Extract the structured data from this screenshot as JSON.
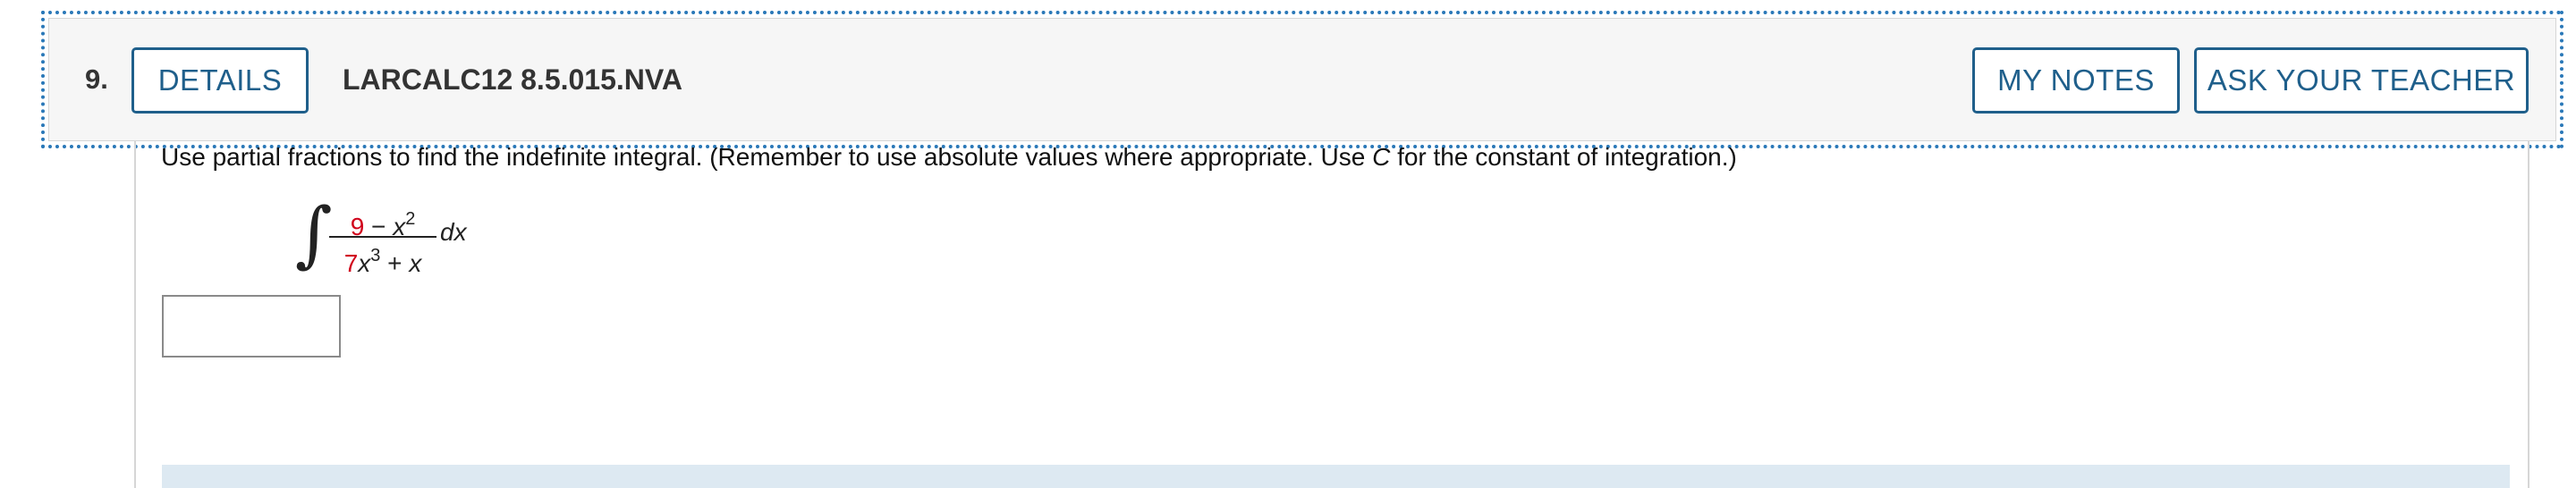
{
  "question": {
    "number": "9.",
    "details_label": "DETAILS",
    "code": "LARCALC12 8.5.015.NVA",
    "my_notes_label": "MY NOTES",
    "ask_teacher_label": "ASK YOUR TEACHER"
  },
  "prompt": {
    "text_before": "Use partial fractions to find the indefinite integral. (Remember to use absolute values where appropriate. Use ",
    "constant": "C",
    "text_after": " for the constant of integration.)"
  },
  "integral": {
    "sign": "∫",
    "num_coef": "9",
    "num_rest": " − ",
    "num_var": "x",
    "num_exp": "2",
    "den_coef": "7",
    "den_var": "x",
    "den_exp": "3",
    "den_rest": " + ",
    "den_var2": "x",
    "differential": "dx"
  },
  "answer": {
    "value": ""
  },
  "colors": {
    "accent": "#1f5f8b",
    "highlight_red": "#d0021b",
    "focus_outline": "#2a78b8"
  }
}
